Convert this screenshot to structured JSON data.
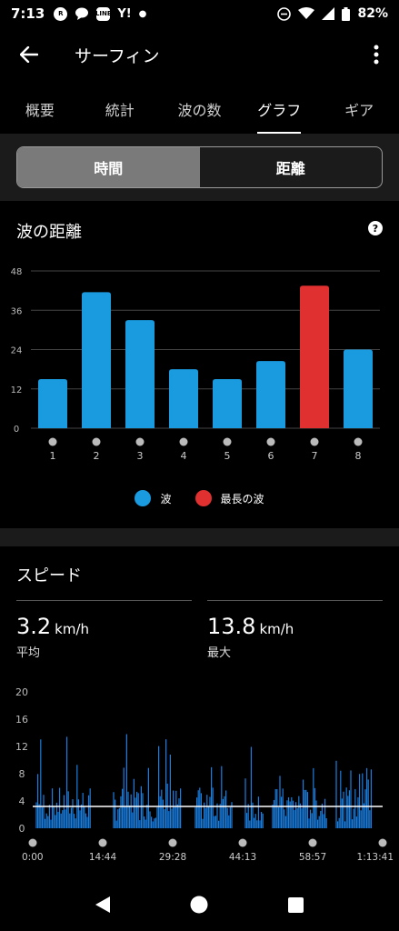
{
  "status": {
    "time": "7:13",
    "battery": "82%"
  },
  "appbar": {
    "title": "サーフィン"
  },
  "tabs": [
    {
      "label": "概要"
    },
    {
      "label": "統計"
    },
    {
      "label": "波の数"
    },
    {
      "label": "グラフ",
      "active": true
    },
    {
      "label": "ギア"
    }
  ],
  "segment": {
    "time_label": "時間",
    "distance_label": "距離",
    "selected": "時間"
  },
  "wave_card": {
    "title": "波の距離",
    "legend": [
      {
        "label": "波",
        "color": "#1a9be0"
      },
      {
        "label": "最長の波",
        "color": "#e03030"
      }
    ]
  },
  "chart_data": [
    {
      "type": "bar",
      "title": "波の距離",
      "categories": [
        "1",
        "2",
        "3",
        "4",
        "5",
        "6",
        "7",
        "8"
      ],
      "values": [
        15,
        41.5,
        33,
        18,
        15,
        20.5,
        43.5,
        24
      ],
      "highlight_index": 6,
      "yticks": [
        "0",
        "12",
        "24",
        "36",
        "48"
      ],
      "ylim": [
        0,
        48
      ],
      "colors": {
        "normal": "#1a9be0",
        "highlight": "#e03030"
      },
      "grid": true
    },
    {
      "type": "area",
      "title": "スピード",
      "yticks": [
        "0",
        "4",
        "8",
        "12",
        "16",
        "20"
      ],
      "ylim": [
        0,
        20
      ],
      "xticks": [
        "0:00",
        "14:44",
        "29:28",
        "44:13",
        "58:57",
        "1:13:41"
      ],
      "average_line": 3.2,
      "color": "#1a7ee0"
    }
  ],
  "speed_card": {
    "title": "スピード",
    "avg_value": "3.2",
    "avg_unit": "km/h",
    "avg_label": "平均",
    "max_value": "13.8",
    "max_unit": "km/h",
    "max_label": "最大"
  }
}
